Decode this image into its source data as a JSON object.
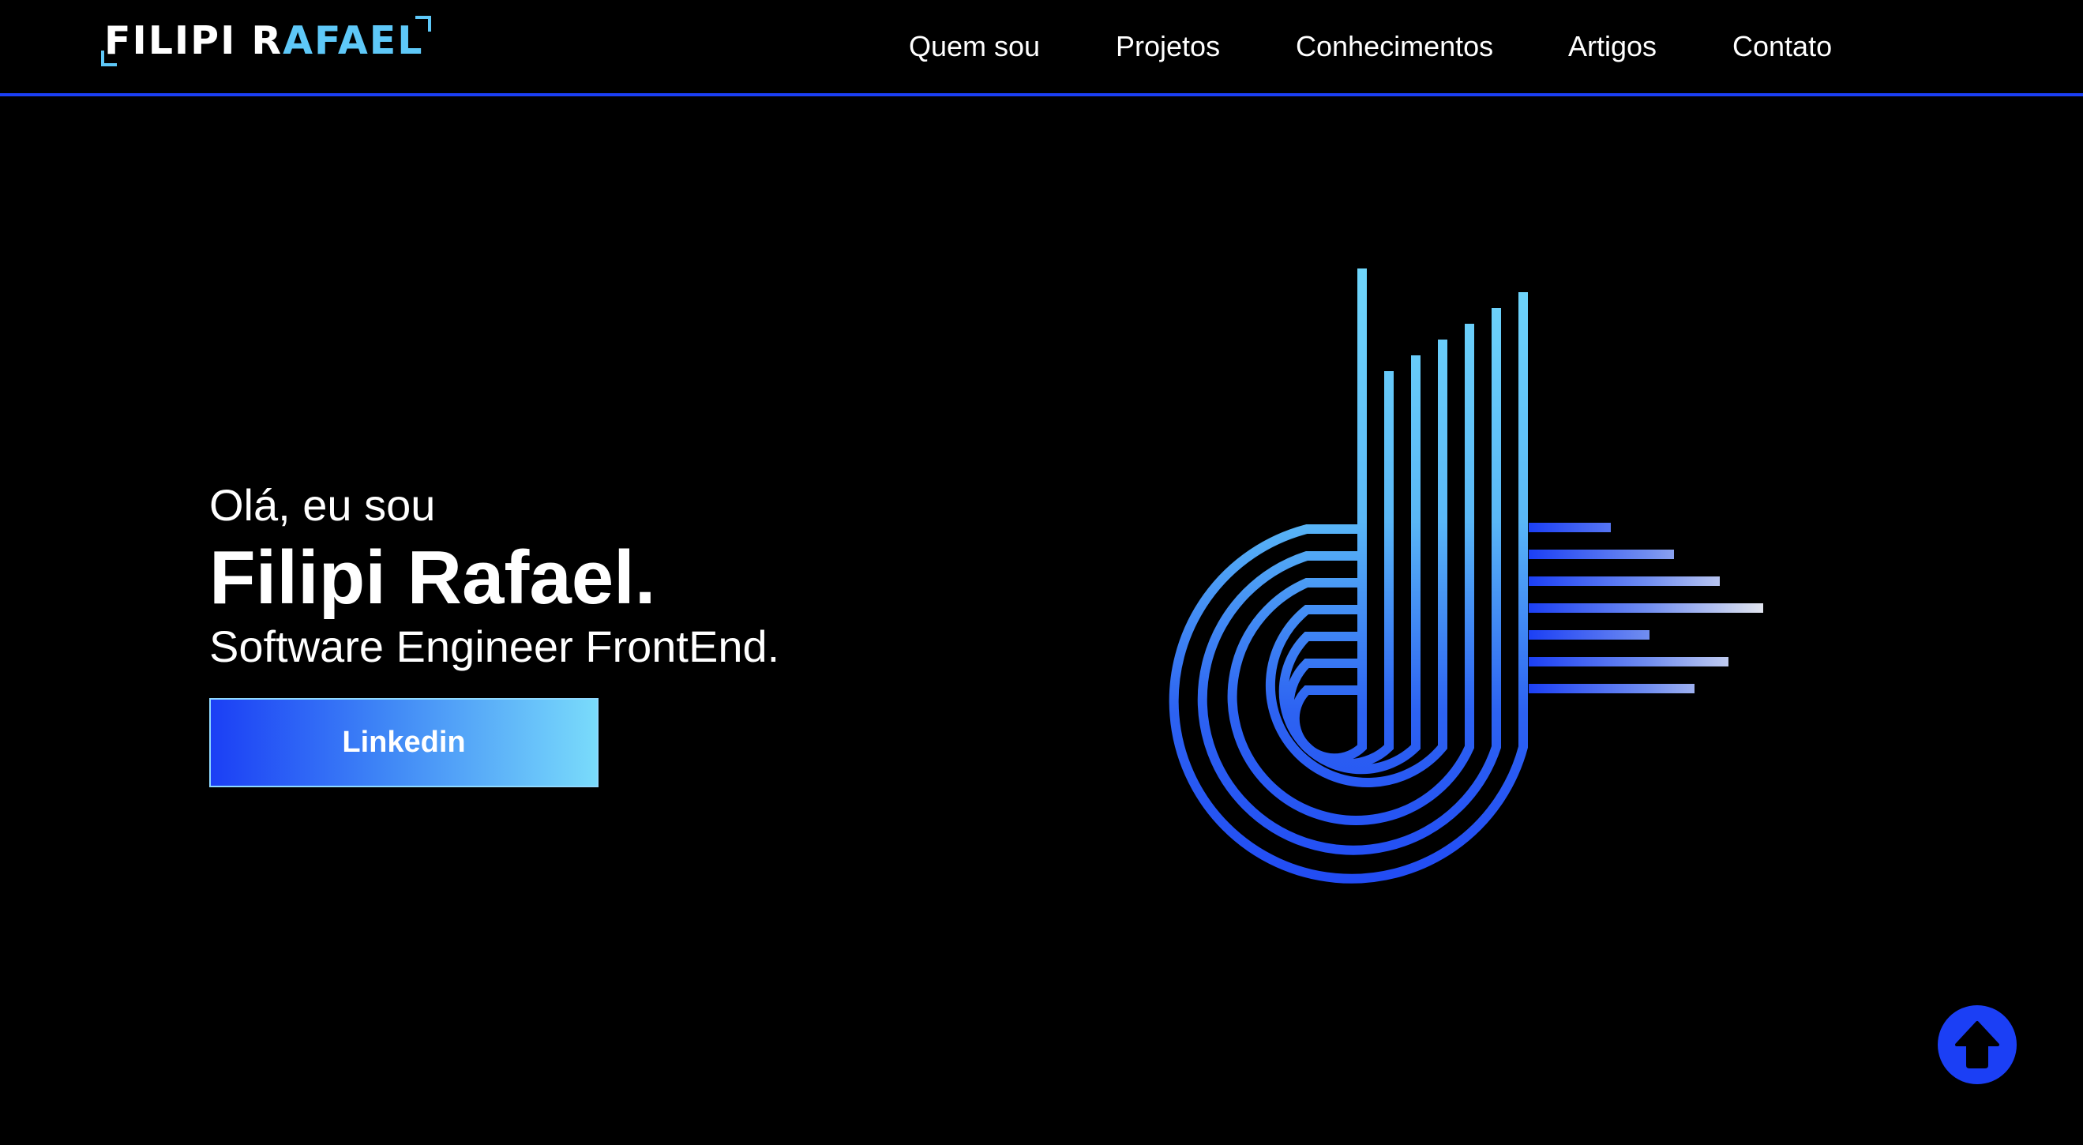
{
  "logo": {
    "part1": "FILIPI R",
    "part2": "AFAEL"
  },
  "nav": {
    "items": [
      {
        "label": "Quem sou"
      },
      {
        "label": "Projetos"
      },
      {
        "label": "Conhecimentos"
      },
      {
        "label": "Artigos"
      },
      {
        "label": "Contato"
      }
    ]
  },
  "hero": {
    "greeting": "Olá, eu sou",
    "name": "Filipi Rafael.",
    "role": "Software Engineer FrontEnd.",
    "cta_label": "Linkedin"
  },
  "icons": {
    "scroll_top": "arrow-up-icon",
    "art": "music-note-line-art"
  },
  "colors": {
    "background": "#000000",
    "accent_blue": "#1b3ff5",
    "accent_cyan": "#5ec8f8",
    "text": "#ffffff"
  }
}
